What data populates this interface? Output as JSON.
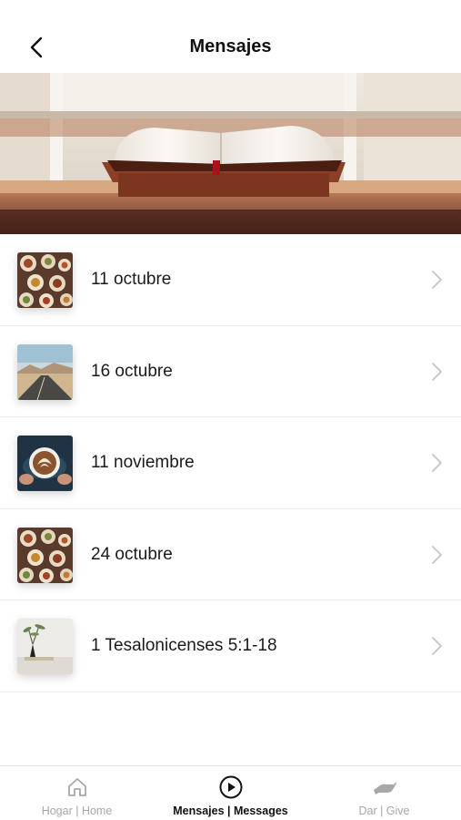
{
  "header": {
    "title": "Mensajes",
    "back_icon": "chevron-left-icon"
  },
  "hero": {
    "image": "open-bible-on-lectern"
  },
  "messages": [
    {
      "label": "11 octubre",
      "thumbnail": "food-table"
    },
    {
      "label": "16 octubre",
      "thumbnail": "desert-road"
    },
    {
      "label": "11 noviembre",
      "thumbnail": "latte-art"
    },
    {
      "label": "24 octubre",
      "thumbnail": "food-table"
    },
    {
      "label": "1 Tesalonicenses 5:1-18",
      "thumbnail": "vase-plant"
    }
  ],
  "tabs": [
    {
      "label": "Hogar | Home",
      "icon": "home-icon",
      "active": false
    },
    {
      "label": "Mensajes | Messages",
      "icon": "play-circle-icon",
      "active": true
    },
    {
      "label": "Dar | Give",
      "icon": "give-hand-icon",
      "active": false
    }
  ],
  "colors": {
    "active_tab": "#111111",
    "inactive_tab": "#a7a7a7",
    "divider": "#ececec"
  }
}
